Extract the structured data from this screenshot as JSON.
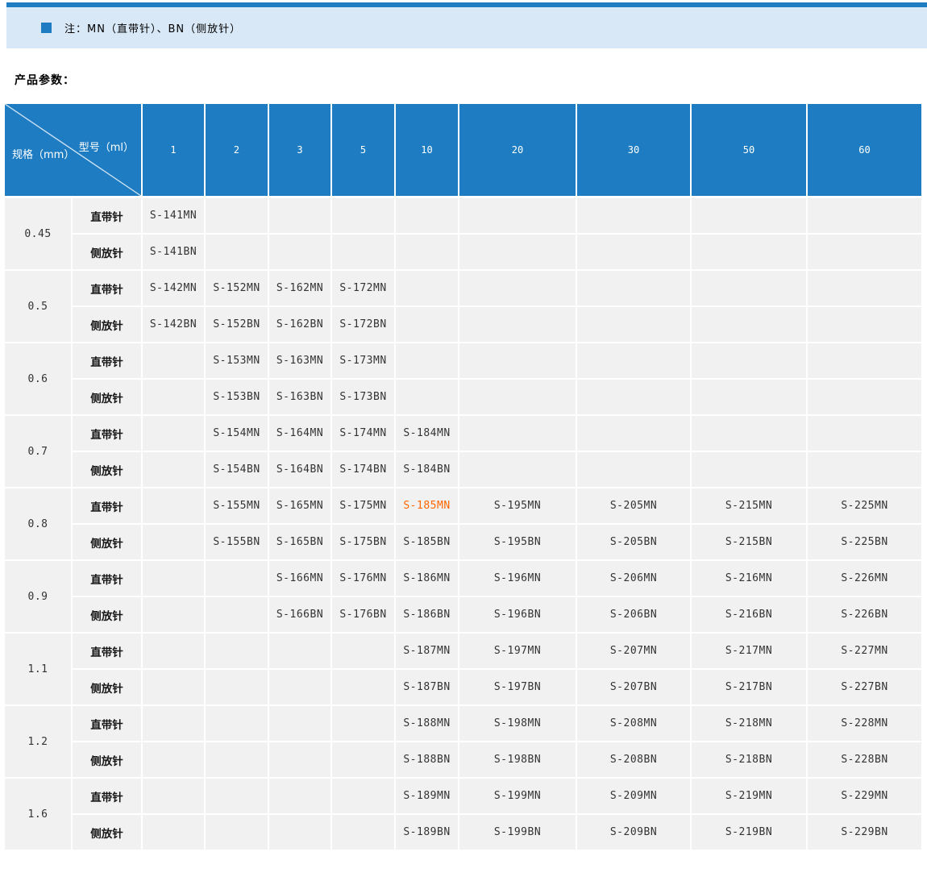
{
  "colors": {
    "accent_blue": "#1e7dc2",
    "banner_bg": "#d9e8f6",
    "cell_bg": "#f1f1f1",
    "highlight_orange": "#ff6600",
    "text_dark": "#333333"
  },
  "note": {
    "text": "注：MN（直带针）、BN（侧放针）"
  },
  "section_title": "产品参数：",
  "table": {
    "corner": {
      "spec_label": "规格（mm）",
      "model_label": "型号（ml）"
    },
    "columns": [
      "1",
      "2",
      "3",
      "5",
      "10",
      "20",
      "30",
      "50",
      "60"
    ],
    "highlight_model": "S-185MN",
    "groups": [
      {
        "spec": "0.45",
        "rows": [
          {
            "label": "直带针",
            "cells": [
              "S-141MN",
              "",
              "",
              "",
              "",
              "",
              "",
              "",
              ""
            ]
          },
          {
            "label": "侧放针",
            "cells": [
              "S-141BN",
              "",
              "",
              "",
              "",
              "",
              "",
              "",
              ""
            ]
          }
        ]
      },
      {
        "spec": "0.5",
        "rows": [
          {
            "label": "直带针",
            "cells": [
              "S-142MN",
              "S-152MN",
              "S-162MN",
              "S-172MN",
              "",
              "",
              "",
              "",
              ""
            ]
          },
          {
            "label": "侧放针",
            "cells": [
              "S-142BN",
              "S-152BN",
              "S-162BN",
              "S-172BN",
              "",
              "",
              "",
              "",
              ""
            ]
          }
        ]
      },
      {
        "spec": "0.6",
        "rows": [
          {
            "label": "直带针",
            "cells": [
              "",
              "S-153MN",
              "S-163MN",
              "S-173MN",
              "",
              "",
              "",
              "",
              ""
            ]
          },
          {
            "label": "侧放针",
            "cells": [
              "",
              "S-153BN",
              "S-163BN",
              "S-173BN",
              "",
              "",
              "",
              "",
              ""
            ]
          }
        ]
      },
      {
        "spec": "0.7",
        "rows": [
          {
            "label": "直带针",
            "cells": [
              "",
              "S-154MN",
              "S-164MN",
              "S-174MN",
              "S-184MN",
              "",
              "",
              "",
              ""
            ]
          },
          {
            "label": "侧放针",
            "cells": [
              "",
              "S-154BN",
              "S-164BN",
              "S-174BN",
              "S-184BN",
              "",
              "",
              "",
              ""
            ]
          }
        ]
      },
      {
        "spec": "0.8",
        "rows": [
          {
            "label": "直带针",
            "cells": [
              "",
              "S-155MN",
              "S-165MN",
              "S-175MN",
              "S-185MN",
              "S-195MN",
              "S-205MN",
              "S-215MN",
              "S-225MN"
            ]
          },
          {
            "label": "侧放针",
            "cells": [
              "",
              "S-155BN",
              "S-165BN",
              "S-175BN",
              "S-185BN",
              "S-195BN",
              "S-205BN",
              "S-215BN",
              "S-225BN"
            ]
          }
        ]
      },
      {
        "spec": "0.9",
        "rows": [
          {
            "label": "直带针",
            "cells": [
              "",
              "",
              "S-166MN",
              "S-176MN",
              "S-186MN",
              "S-196MN",
              "S-206MN",
              "S-216MN",
              "S-226MN"
            ]
          },
          {
            "label": "侧放针",
            "cells": [
              "",
              "",
              "S-166BN",
              "S-176BN",
              "S-186BN",
              "S-196BN",
              "S-206BN",
              "S-216BN",
              "S-226BN"
            ]
          }
        ]
      },
      {
        "spec": "1.1",
        "rows": [
          {
            "label": "直带针",
            "cells": [
              "",
              "",
              "",
              "",
              "S-187MN",
              "S-197MN",
              "S-207MN",
              "S-217MN",
              "S-227MN"
            ]
          },
          {
            "label": "侧放针",
            "cells": [
              "",
              "",
              "",
              "",
              "S-187BN",
              "S-197BN",
              "S-207BN",
              "S-217BN",
              "S-227BN"
            ]
          }
        ]
      },
      {
        "spec": "1.2",
        "rows": [
          {
            "label": "直带针",
            "cells": [
              "",
              "",
              "",
              "",
              "S-188MN",
              "S-198MN",
              "S-208MN",
              "S-218MN",
              "S-228MN"
            ]
          },
          {
            "label": "侧放针",
            "cells": [
              "",
              "",
              "",
              "",
              "S-188BN",
              "S-198BN",
              "S-208BN",
              "S-218BN",
              "S-228BN"
            ]
          }
        ]
      },
      {
        "spec": "1.6",
        "rows": [
          {
            "label": "直带针",
            "cells": [
              "",
              "",
              "",
              "",
              "S-189MN",
              "S-199MN",
              "S-209MN",
              "S-219MN",
              "S-229MN"
            ]
          },
          {
            "label": "侧放针",
            "cells": [
              "",
              "",
              "",
              "",
              "S-189BN",
              "S-199BN",
              "S-209BN",
              "S-219BN",
              "S-229BN"
            ]
          }
        ]
      }
    ]
  }
}
